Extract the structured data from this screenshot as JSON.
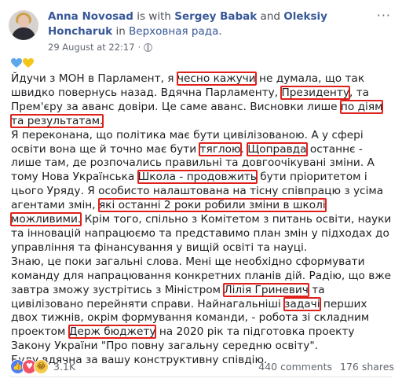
{
  "header": {
    "author": "Anna Novosad",
    "is_with": " is with ",
    "tagged_1": "Sergey Babak",
    "and": " and ",
    "tagged_2": "Oleksiy Honcharuk",
    "in": " in ",
    "location": "Верховная рада",
    "period": ".",
    "timestamp": "29 August at 22:17",
    "separator": "·",
    "more": "···"
  },
  "hearts": [
    "blue-heart-icon",
    "yellow-heart-icon"
  ],
  "colors": {
    "heart_blue": "#5ea8e8",
    "heart_yellow": "#f5c518",
    "highlight": "#e0211b",
    "link": "#385898"
  },
  "body": {
    "p1_a": "Йдучи з МОН в Парламент, я ",
    "p1_h1": "чесно кажучи",
    "p1_b": " не думала, що так швидко повернусь назад. Вдячна Парламенту, ",
    "p1_h2": "Президенту",
    "p1_c": ", та Прем'єру за аванс довіри. Це саме аванс. Висновки лише ",
    "p1_h3": "по діям та результатам.",
    "p2_a": "Я переконана, що політика має бути цивілізованою. А у сфері освіти вона ще й точно має бути ",
    "p2_h1": "тяглою",
    "p2_b": ". ",
    "p2_h2": "Щоправда",
    "p2_c": " останнє - лише там, де розпочались правильні та довгоочікувані зміни. А тому Нова Українська ",
    "p2_h3": "Школа - продовжить",
    "p2_d": " бути пріоритетом і цього Уряду. Я особисто налаштована на тісну співпрацю з усіма агентами змін, ",
    "p2_h4": "які останні 2 роки робили зміни в школі можливими.",
    "p2_e": " Крім того, спільно з Комітетом з питань освіти, науки та інновацій напрацюємо та представимо план змін у підходах до управління та фінансування у вищій освіті та науці.",
    "p3_a": "Знаю, це поки загальні слова. Мені ще необхідно сформувати команду для напрацювання конкретних планів дій. Радію, що вже завтра зможу зустрітись з Міністром ",
    "p3_h1": "Лілія Гриневич",
    "p3_b": " та цивілізовано перейняти справи. Найнагальніші ",
    "p3_h2": "задачі",
    "p3_c": " перших двох тижнів, окрім формування команди, - робота зі складним проектом ",
    "p3_h3": "Держ бюджету",
    "p3_d": " на 2020 рік та підготовка проекту Закону України \"Про повну загальну середню освіту\".",
    "p4": "Буду вдячна за вашу конструктивну співдію."
  },
  "footer": {
    "reactions_count": "3.1K",
    "comments": "440 comments",
    "shares": "176 shares"
  }
}
